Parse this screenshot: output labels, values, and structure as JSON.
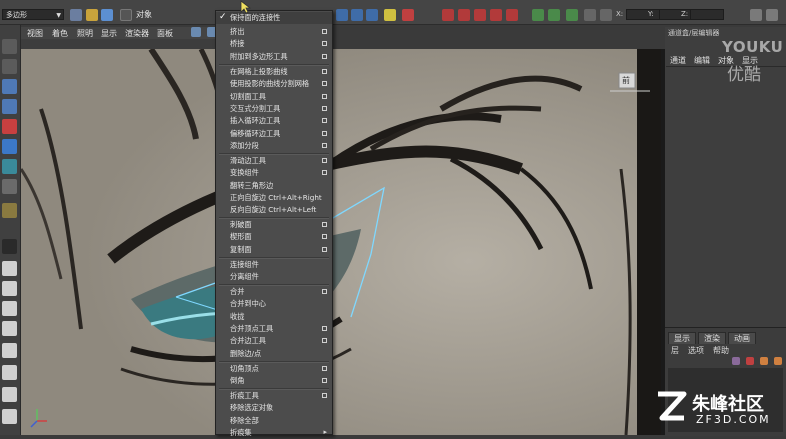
{
  "toolbar": {
    "mode_select": "多边形",
    "object_label": "对象",
    "coord_labels": [
      "X:",
      "Y:",
      "Z:"
    ]
  },
  "viewport_menu": [
    "视图",
    "着色",
    "照明",
    "显示",
    "渲染器",
    "面板"
  ],
  "view_cube_label": "前",
  "menu": {
    "items": [
      {
        "label": "保持面的连接性",
        "check": true,
        "option": false,
        "submenu": false
      },
      {
        "label": "挤出",
        "check": false,
        "option": true,
        "submenu": false
      },
      {
        "label": "桥接",
        "check": false,
        "option": true,
        "submenu": false
      },
      {
        "label": "附加到多边形工具",
        "check": false,
        "option": true,
        "submenu": false
      },
      {
        "label": "在网格上投影曲线",
        "check": false,
        "option": true,
        "submenu": false
      },
      {
        "label": "使用投影的曲线分割网格",
        "check": false,
        "option": true,
        "submenu": false
      },
      {
        "label": "切割面工具",
        "check": false,
        "option": true,
        "submenu": false
      },
      {
        "label": "交互式分割工具",
        "check": false,
        "option": true,
        "submenu": false
      },
      {
        "label": "插入循环边工具",
        "check": false,
        "option": true,
        "submenu": false
      },
      {
        "label": "偏移循环边工具",
        "check": false,
        "option": true,
        "submenu": false
      },
      {
        "label": "添加分段",
        "check": false,
        "option": true,
        "submenu": false
      },
      {
        "label": "滑动边工具",
        "check": false,
        "option": true,
        "submenu": false
      },
      {
        "label": "变换组件",
        "check": false,
        "option": true,
        "submenu": false
      },
      {
        "label": "翻转三角形边",
        "check": false,
        "option": false,
        "submenu": false
      },
      {
        "label": "正向自旋边   Ctrl+Alt+Right",
        "check": false,
        "option": false,
        "submenu": false
      },
      {
        "label": "反向自旋边   Ctrl+Alt+Left",
        "check": false,
        "option": false,
        "submenu": false
      },
      {
        "label": "刺破面",
        "check": false,
        "option": true,
        "submenu": false
      },
      {
        "label": "楔形面",
        "check": false,
        "option": true,
        "submenu": false
      },
      {
        "label": "复制面",
        "check": false,
        "option": true,
        "submenu": false
      },
      {
        "label": "连接组件",
        "check": false,
        "option": false,
        "submenu": false
      },
      {
        "label": "分离组件",
        "check": false,
        "option": false,
        "submenu": false
      },
      {
        "label": "合并",
        "check": false,
        "option": true,
        "submenu": false
      },
      {
        "label": "合并到中心",
        "check": false,
        "option": false,
        "submenu": false
      },
      {
        "label": "收拢",
        "check": false,
        "option": false,
        "submenu": false
      },
      {
        "label": "合并顶点工具",
        "check": false,
        "option": true,
        "submenu": false
      },
      {
        "label": "合并边工具",
        "check": false,
        "option": true,
        "submenu": false
      },
      {
        "label": "删除边/点",
        "check": false,
        "option": false,
        "submenu": false
      },
      {
        "label": "切角顶点",
        "check": false,
        "option": true,
        "submenu": false
      },
      {
        "label": "倒角",
        "check": false,
        "option": true,
        "submenu": false
      },
      {
        "label": "折痕工具",
        "check": false,
        "option": true,
        "submenu": false
      },
      {
        "label": "移除选定对象",
        "check": false,
        "option": false,
        "submenu": false
      },
      {
        "label": "移除全部",
        "check": false,
        "option": false,
        "submenu": false
      },
      {
        "label": "折痕集",
        "check": false,
        "option": false,
        "submenu": true
      }
    ]
  },
  "channel_box": {
    "title": "通道盒/层编辑器",
    "tabs": [
      "通道",
      "编辑",
      "对象",
      "显示"
    ]
  },
  "layer_panel": {
    "tabs": [
      "显示",
      "渲染",
      "动画"
    ],
    "subtabs": [
      "层",
      "选项",
      "帮助"
    ]
  },
  "watermarks": {
    "youku": "YOUKU",
    "youku_cn": "优酷",
    "zf_name": "朱峰社区",
    "zf_url": "ZF3D.COM"
  },
  "colors": {
    "menu_bg": "#4c4c4c",
    "panel_bg": "#3e3e3e",
    "selection_edge": "#7fd8ff",
    "skin": "#a19b90"
  }
}
